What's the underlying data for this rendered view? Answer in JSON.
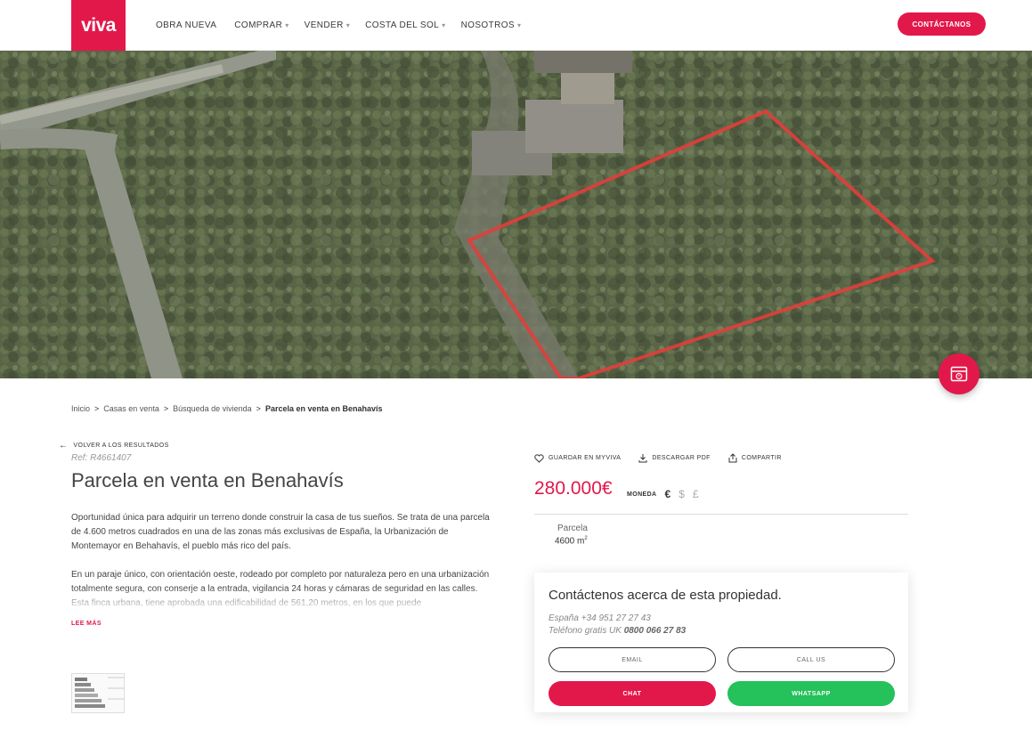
{
  "header": {
    "logo": "viva",
    "nav": [
      {
        "label": "OBRA NUEVA",
        "caret": ""
      },
      {
        "label": "COMPRAR",
        "caret": "▾"
      },
      {
        "label": "VENDER",
        "caret": "▾"
      },
      {
        "label": "COSTA DEL SOL",
        "caret": "▾"
      },
      {
        "label": "NOSOTROS",
        "caret": "▾"
      }
    ],
    "contact_button": "CONTÁCTANOS"
  },
  "breadcrumb": {
    "items": [
      "Inicio",
      "Casas en venta",
      "Búsqueda de vivienda"
    ],
    "current": "Parcela en venta en Benahavís",
    "separator": ">"
  },
  "property": {
    "back_link": "VOLVER A LOS RESULTADOS",
    "ref": "Ref: R4661407",
    "title": "Parcela en venta en Benahavís",
    "description": [
      "Oportunidad única para adquirir un terreno donde construir la casa de tus sueños. Se trata de una parcela de 4.600 metros cuadrados en una de las zonas más exclusivas de España, la Urbanización de Montemayor en Behahavís, el pueblo más rico del país.",
      "En un paraje único, con orientación oeste, rodeado por completo por naturaleza pero en una urbanización totalmente segura, con conserje a la entrada, vigilancia 24 horas y cámaras de seguridad en las calles. Esta finca urbana, tiene aprobada una edificabilidad de 561,20 metros, en los que puede"
    ],
    "read_more": "LEE MÁS"
  },
  "actions": {
    "save": "GUARDAR EN MYVIVA",
    "download": "DESCARGAR PDF",
    "share": "COMPARTIR"
  },
  "price": {
    "value": "280.000€",
    "currency_label": "MONEDA",
    "currencies": [
      "€",
      "$",
      "£"
    ],
    "active_currency": "€"
  },
  "features": {
    "label": "Parcela",
    "value": "4600 m",
    "unit_sup": "2"
  },
  "contact": {
    "title": "Contáctenos acerca de esta propiedad.",
    "spain_label": "España",
    "spain_phone": "+34 951 27 27 43",
    "uk_label": "Teléfono gratis UK",
    "uk_phone": "0800 066 27 83",
    "email_button": "EMAIL",
    "call_button": "CALL US",
    "chat_button": "CHAT",
    "whatsapp_button": "WHATSAPP"
  },
  "colors": {
    "brand": "#e2184b",
    "whatsapp": "#25c15b"
  },
  "icons": {
    "save": "heart-icon",
    "download": "download-icon",
    "share": "share-icon",
    "back": "arrow-left-icon",
    "fab": "calendar-icon"
  }
}
